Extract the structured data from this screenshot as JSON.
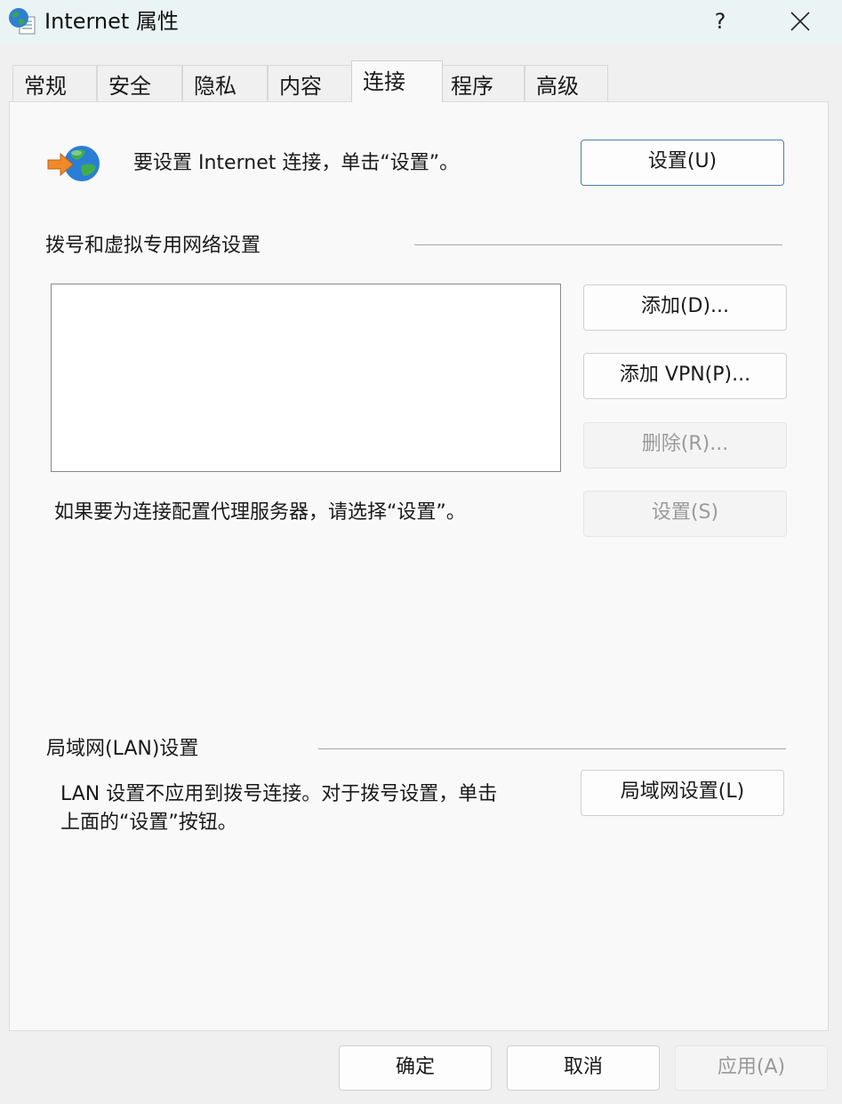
{
  "window": {
    "title": "Internet 属性",
    "help_label": "?",
    "close_icon": "close-icon",
    "app_icon": "internet-globe-icon"
  },
  "tabs": [
    {
      "label": "常规",
      "active": false
    },
    {
      "label": "安全",
      "active": false
    },
    {
      "label": "隐私",
      "active": false
    },
    {
      "label": "内容",
      "active": false
    },
    {
      "label": "连接",
      "active": true
    },
    {
      "label": "程序",
      "active": false
    },
    {
      "label": "高级",
      "active": false
    }
  ],
  "connection": {
    "icon": "globe-arrow-icon",
    "intro_text": "要设置 Internet 连接，单击“设置”。",
    "setup_button": "设置(U)"
  },
  "dialup": {
    "section_title": "拨号和虚拟专用网络设置",
    "connections": [],
    "add_button": "添加(D)...",
    "add_vpn_button": "添加 VPN(P)...",
    "remove_button": "删除(R)...",
    "settings_button": "设置(S)",
    "proxy_text": "如果要为连接配置代理服务器，请选择“设置”。"
  },
  "lan": {
    "section_title": "局域网(LAN)设置",
    "description_line1": "LAN 设置不应用到拨号连接。对于拨号设置，单击",
    "description_line2": "上面的“设置”按钮。",
    "lan_settings_button": "局域网设置(L)"
  },
  "footer": {
    "ok_button": "确定",
    "cancel_button": "取消",
    "apply_button": "应用(A)"
  },
  "colors": {
    "titlebar": "#eaf4f4",
    "panel": "#f9f9f9",
    "primary_border": "#4f7fa8",
    "disabled_text": "#9a9a9a"
  }
}
